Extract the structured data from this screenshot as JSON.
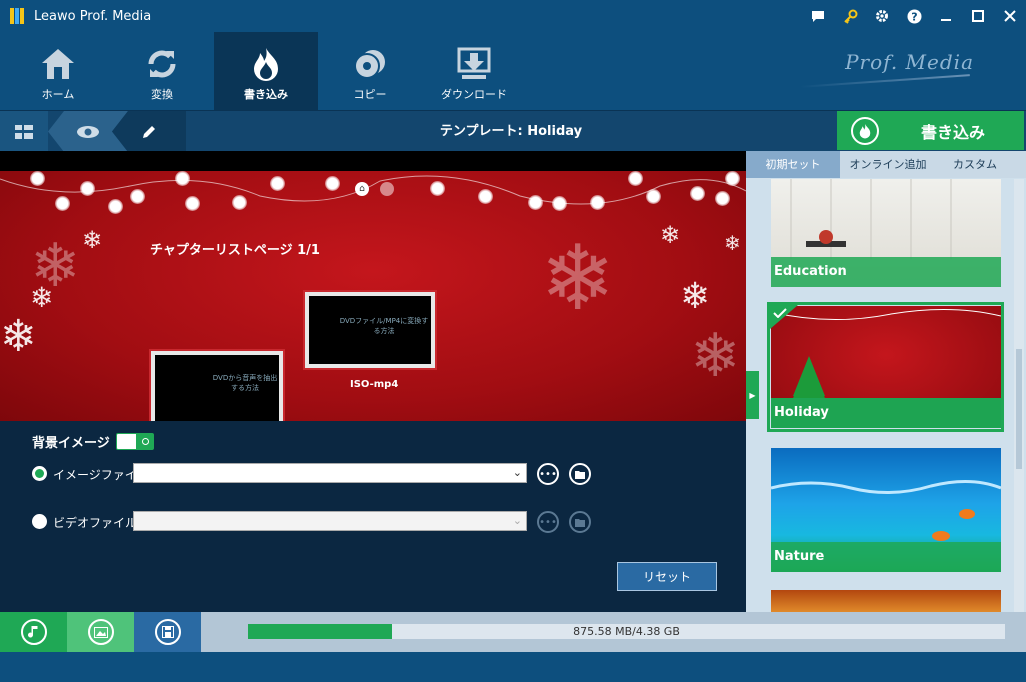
{
  "window": {
    "title": "Leawo Prof. Media"
  },
  "nav_tabs": [
    {
      "label": "ホーム",
      "icon": "home-icon"
    },
    {
      "label": "変換",
      "icon": "convert-icon"
    },
    {
      "label": "書き込み",
      "icon": "burn-icon",
      "active": true
    },
    {
      "label": "コピー",
      "icon": "copy-icon"
    },
    {
      "label": "ダウンロード",
      "icon": "download-icon"
    }
  ],
  "brand": "Prof. Media",
  "subbar": {
    "template_title": "テンプレート: Holiday"
  },
  "burn_button": {
    "label": "書き込み"
  },
  "preview": {
    "chapter_title": "チャプターリストページ 1/1",
    "thumbs": [
      {
        "caption": "ISO-mp4",
        "text": "DVDファイル/MP4に変換する方法"
      },
      {
        "caption": "",
        "text": "DVDから音声を抽出する方法"
      }
    ]
  },
  "settings": {
    "background_label": "背景イメージ",
    "image_file_label": "イメージファイル",
    "video_file_label": "ビデオファイル",
    "reset_label": "リセット"
  },
  "side_tabs": [
    "初期セット",
    "オンライン追加",
    "カスタム"
  ],
  "templates": [
    {
      "name": "Education"
    },
    {
      "name": "Holiday",
      "selected": true
    },
    {
      "name": "Nature"
    }
  ],
  "progress": {
    "text": "875.58 MB/4.38 GB",
    "fraction": 0.19
  },
  "colors": {
    "accent": "#1fa855",
    "chrome": "#0d4f7e",
    "holiday_red": "#b3121a"
  }
}
